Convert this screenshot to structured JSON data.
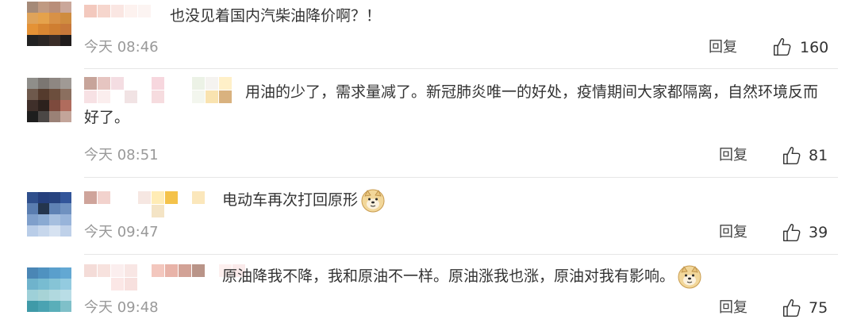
{
  "comments": [
    {
      "text": "也没见着国内汽柴油降价啊？！",
      "time": "今天 08:46",
      "reply_label": "回复",
      "likes": "160",
      "has_emoji": false
    },
    {
      "text": "用油的少了，需求量减了。新冠肺炎唯一的好处，疫情期间大家都隔离，自然环境反而好了。",
      "time": "今天 08:51",
      "reply_label": "回复",
      "likes": "81",
      "has_emoji": false
    },
    {
      "text": "电动车再次打回原形",
      "time": "今天 09:47",
      "reply_label": "回复",
      "likes": "39",
      "has_emoji": true,
      "emoji_name": "doge-emoji"
    },
    {
      "text": "原油降我不降，我和原油不一样。原油涨我也涨，原油对我有影响。",
      "time": "今天 09:48",
      "reply_label": "回复",
      "likes": "75",
      "has_emoji": true,
      "emoji_name": "doge-emoji"
    }
  ],
  "colors": {
    "text": "#333333",
    "meta": "#999999",
    "divider": "#e6e6e6"
  },
  "icons": {
    "like": "thumbs-up-icon"
  }
}
